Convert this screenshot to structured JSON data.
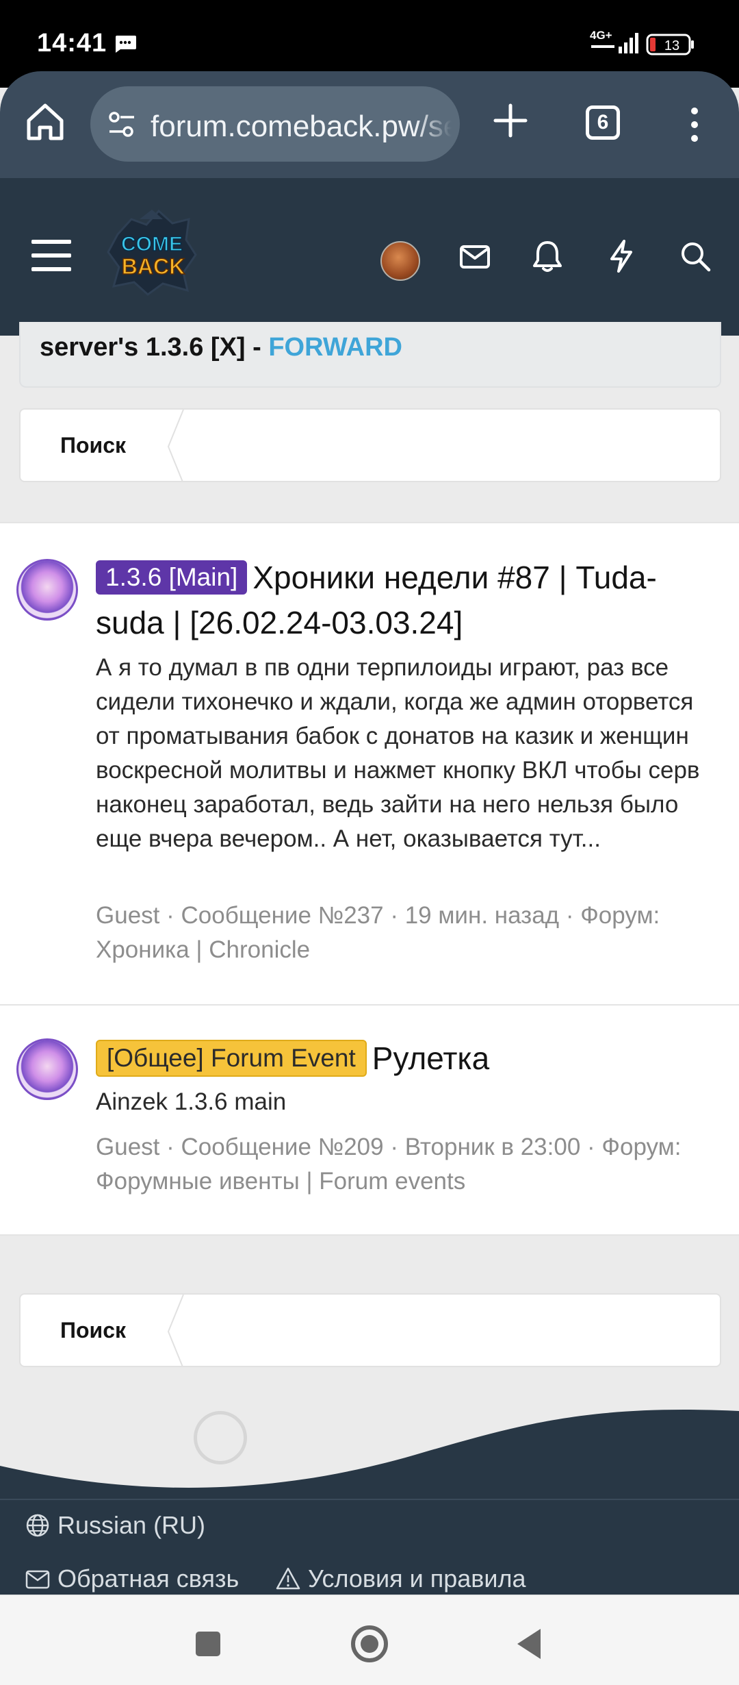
{
  "status_bar": {
    "time": "14:41",
    "network": "4G+",
    "battery": "13"
  },
  "browser": {
    "url": "forum.comeback.pw/search",
    "tab_count": "6"
  },
  "forum": {
    "logo_text_top": "COME",
    "logo_text_bottom": "BACK"
  },
  "top_card": {
    "text": "server's 1.3.6 [X] - ",
    "link": "FORWARD"
  },
  "search_label": "Поиск",
  "results": [
    {
      "prefix": "1.3.6 [Main]",
      "prefix_color": "#5e36a8",
      "title": "Хроники недели #87 | Tuda-suda | [26.02.24-03.03.24]",
      "snippet": "А я то думал в пв одни терпилоиды играют, раз все сидели тихонечко и ждали, когда же админ оторвется от проматывания бабок с донатов на казик и женщин воскресной молитвы и нажмет кнопку ВКЛ чтобы серв наконец заработал, ведь зайти на него нельзя было еще вчера вечером.. А нет, оказывается тут...",
      "meta": "Guest · Сообщение №237 · 19 мин. назад · Форум: Хроника | Chronicle"
    },
    {
      "prefix": "[Общее] Forum Event",
      "prefix_color": "#f6c33a",
      "title": "Рулетка",
      "snippet": "Ainzek 1.3.6 main",
      "meta": "Guest · Сообщение №209 · Вторник в 23:00 · Форум: Форумные ивенты | Forum events"
    }
  ],
  "footer": {
    "language": "Russian (RU)",
    "feedback": "Обратная связь",
    "terms": "Условия и правила"
  },
  "colors": {
    "header_bg": "#283745",
    "browser_bar": "#3b4b5c",
    "link_accent": "#3fa5d8"
  }
}
